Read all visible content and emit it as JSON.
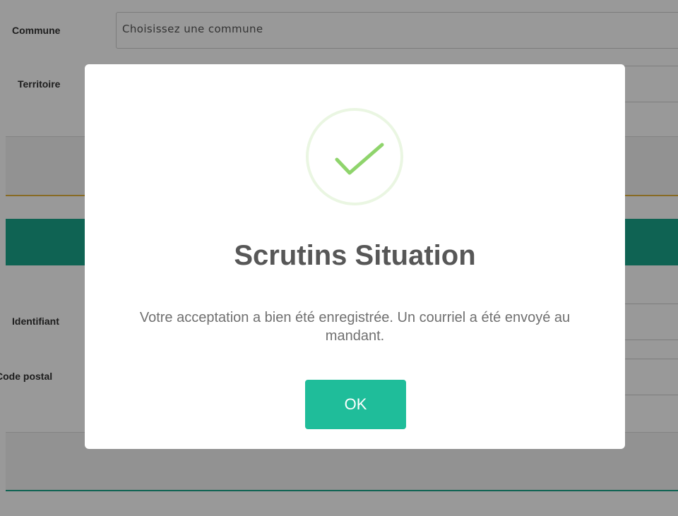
{
  "form": {
    "commune_label": "Commune",
    "commune_placeholder": "Choisissez une commune",
    "territoire_label": "Territoire",
    "identifiant_label": "Identifiant",
    "code_postal_label": "Code postal"
  },
  "dialog": {
    "title": "Scrutins Situation",
    "message": "Votre acceptation a bien été enregistrée. Un courriel a été envoyé au mandant.",
    "ok_label": "OK",
    "icon": "check-circle-icon"
  },
  "colors": {
    "accent": "#1fbd9a",
    "header_band": "#1aa58a",
    "separator": "#e3b23c",
    "check": "#8fd46c",
    "overlay": "rgba(0,0,0,0.4)"
  }
}
